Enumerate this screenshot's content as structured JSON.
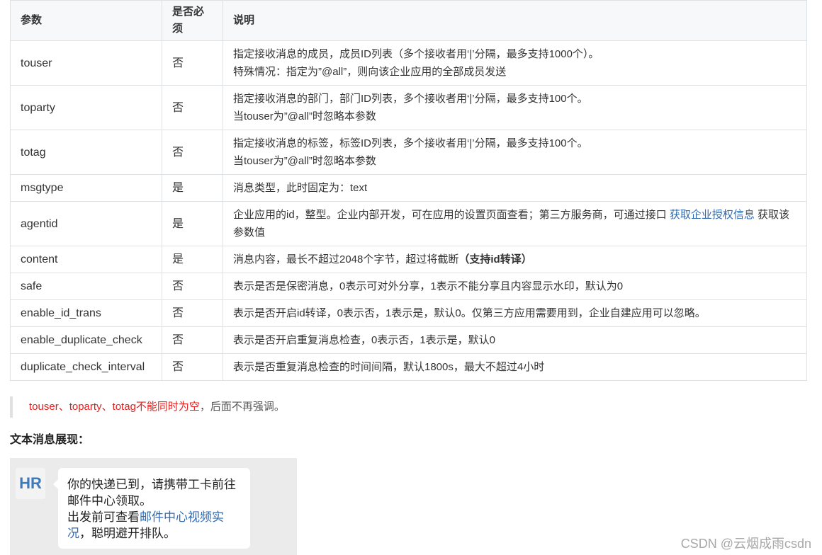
{
  "table": {
    "headers": [
      "参数",
      "是否必须",
      "说明"
    ],
    "rows": [
      {
        "param": "touser",
        "required": "否",
        "desc1": "指定接收消息的成员，成员ID列表（多个接收者用‘|’分隔，最多支持1000个）。",
        "desc2": "特殊情况：指定为”@all”，则向该企业应用的全部成员发送"
      },
      {
        "param": "toparty",
        "required": "否",
        "desc1": "指定接收消息的部门，部门ID列表，多个接收者用‘|’分隔，最多支持100个。",
        "desc2": "当touser为”@all”时忽略本参数"
      },
      {
        "param": "totag",
        "required": "否",
        "desc1": "指定接收消息的标签，标签ID列表，多个接收者用‘|’分隔，最多支持100个。",
        "desc2": "当touser为”@all”时忽略本参数"
      },
      {
        "param": "msgtype",
        "required": "是",
        "desc": "消息类型，此时固定为：text"
      },
      {
        "param": "agentid",
        "required": "是",
        "desc_pre": "企业应用的id，整型。企业内部开发，可在应用的设置页面查看；第三方服务商，可通过接口 ",
        "desc_link": "获取企业授权信息",
        "desc_post": " 获取该参数值"
      },
      {
        "param": "content",
        "required": "是",
        "desc_pre": "消息内容，最长不超过2048个字节，超过将截断",
        "desc_bold": "（支持id转译）"
      },
      {
        "param": "safe",
        "required": "否",
        "desc": "表示是否是保密消息，0表示可对外分享，1表示不能分享且内容显示水印，默认为0"
      },
      {
        "param": "enable_id_trans",
        "required": "否",
        "desc": "表示是否开启id转译，0表示否，1表示是，默认0。仅第三方应用需要用到，企业自建应用可以忽略。"
      },
      {
        "param": "enable_duplicate_check",
        "required": "否",
        "desc": "表示是否开启重复消息检查，0表示否，1表示是，默认0"
      },
      {
        "param": "duplicate_check_interval",
        "required": "否",
        "desc": "表示是否重复消息检查的时间间隔，默认1800s，最大不超过4小时"
      }
    ]
  },
  "note": {
    "red": "touser、toparty、totag不能同时为空",
    "rest": "，后面不再强调。"
  },
  "subtitle": "文本消息展现：",
  "preview": {
    "avatar": "HR",
    "text1": "你的快递已到，请携带工卡前往邮件中心领取。",
    "text2": "出发前可查看",
    "link": "邮件中心视频实况",
    "text3": "，聪明避开排队。"
  },
  "watermark": "CSDN @云烟成雨csdn",
  "colors": {
    "link": "#2f6ab2",
    "warning": "#e02020",
    "avatar": "#3c7abc"
  }
}
